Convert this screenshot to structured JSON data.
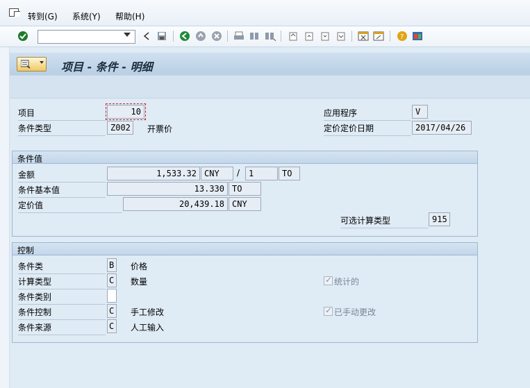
{
  "menubar": {
    "items": [
      "转到(G)",
      "系统(Y)",
      "帮助(H)"
    ]
  },
  "title": "项目 - 条件 - 明细",
  "header": {
    "item": {
      "label": "项目",
      "value": "10"
    },
    "condition_type": {
      "label": "条件类型",
      "value": "Z002",
      "desc": "开票价"
    },
    "application": {
      "label": "应用程序",
      "value": "V"
    },
    "pricing_date": {
      "label": "定价定价日期",
      "value": "2017/04/26"
    }
  },
  "condition_values": {
    "title": "条件值",
    "amount": {
      "label": "金额",
      "value": "1,533.32",
      "currency": "CNY",
      "per": "/",
      "qty": "1",
      "unit": "TO"
    },
    "base": {
      "label": "条件基本值",
      "value": "13.330",
      "unit": "TO"
    },
    "pricing_value": {
      "label": "定价值",
      "value": "20,439.18",
      "currency": "CNY"
    },
    "alt_calc": {
      "label": "可选计算类型",
      "value": "915"
    }
  },
  "control": {
    "title": "控制",
    "class": {
      "label": "条件类",
      "value": "B",
      "desc": "价格"
    },
    "calc_type": {
      "label": "计算类型",
      "value": "C",
      "desc": "数量"
    },
    "category": {
      "label": "条件类别",
      "value": ""
    },
    "ctrl": {
      "label": "条件控制",
      "value": "C",
      "desc": "手工修改"
    },
    "origin": {
      "label": "条件来源",
      "value": "C",
      "desc": "人工输入"
    },
    "statistical": {
      "label": "统计的",
      "checked": true
    },
    "manual_changed": {
      "label": "已手动更改",
      "checked": true
    }
  },
  "toolbar_icons": [
    "enter-icon",
    "back-arrow-icon",
    "save-icon",
    "back-icon",
    "exit-icon",
    "cancel-icon",
    "print-icon",
    "find-icon",
    "find-next-icon",
    "first-page-icon",
    "prev-page-icon",
    "next-page-icon",
    "last-page-icon",
    "new-session-icon",
    "shortcut-icon",
    "help-icon",
    "layout-icon"
  ]
}
